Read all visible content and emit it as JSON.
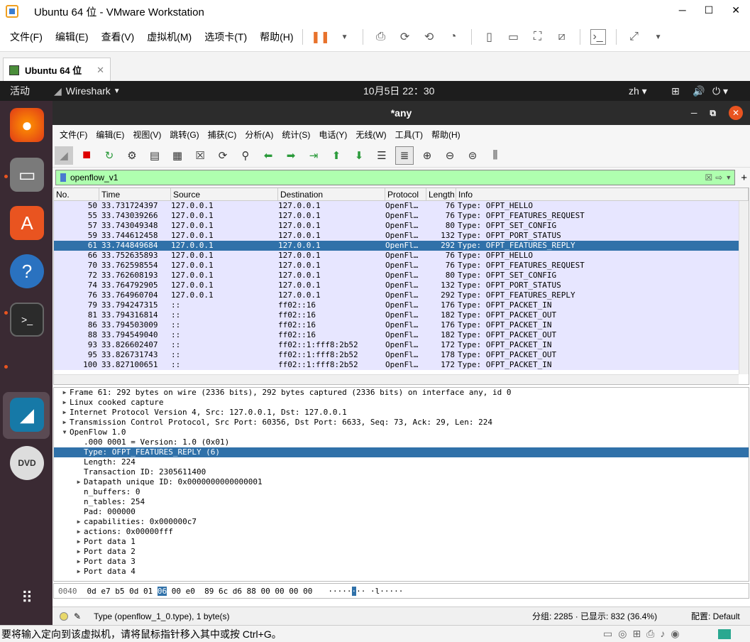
{
  "vmware": {
    "title": "Ubuntu 64 位 - VMware Workstation",
    "menu": [
      "文件(F)",
      "编辑(E)",
      "查看(V)",
      "虚拟机(M)",
      "选项卡(T)",
      "帮助(H)"
    ],
    "tab_label": "Ubuntu 64 位",
    "status_message": "要将输入定向到该虚拟机，请将鼠标指针移入其中或按 Ctrl+G。"
  },
  "gnome": {
    "activities": "活动",
    "app_name": "Wireshark",
    "clock": "10月5日  22：30",
    "input_method": "zh"
  },
  "wireshark": {
    "window_title": "*any",
    "menu": [
      "文件(F)",
      "编辑(E)",
      "视图(V)",
      "跳转(G)",
      "捕获(C)",
      "分析(A)",
      "统计(S)",
      "电话(Y)",
      "无线(W)",
      "工具(T)",
      "帮助(H)"
    ],
    "filter_value": "openflow_v1",
    "columns": [
      "No.",
      "Time",
      "Source",
      "Destination",
      "Protocol",
      "Length",
      "Info"
    ],
    "packets": [
      {
        "no": "50",
        "time": "33.731724397",
        "src": "127.0.0.1",
        "dst": "127.0.0.1",
        "proto": "OpenFl…",
        "len": "76",
        "info": "Type: OFPT_HELLO"
      },
      {
        "no": "55",
        "time": "33.743039266",
        "src": "127.0.0.1",
        "dst": "127.0.0.1",
        "proto": "OpenFl…",
        "len": "76",
        "info": "Type: OFPT_FEATURES_REQUEST"
      },
      {
        "no": "57",
        "time": "33.743049348",
        "src": "127.0.0.1",
        "dst": "127.0.0.1",
        "proto": "OpenFl…",
        "len": "80",
        "info": "Type: OFPT_SET_CONFIG"
      },
      {
        "no": "59",
        "time": "33.744612458",
        "src": "127.0.0.1",
        "dst": "127.0.0.1",
        "proto": "OpenFl…",
        "len": "132",
        "info": "Type: OFPT_PORT_STATUS"
      },
      {
        "no": "61",
        "time": "33.744849684",
        "src": "127.0.0.1",
        "dst": "127.0.0.1",
        "proto": "OpenFl…",
        "len": "292",
        "info": "Type: OFPT_FEATURES_REPLY",
        "selected": true
      },
      {
        "no": "66",
        "time": "33.752635893",
        "src": "127.0.0.1",
        "dst": "127.0.0.1",
        "proto": "OpenFl…",
        "len": "76",
        "info": "Type: OFPT_HELLO"
      },
      {
        "no": "70",
        "time": "33.762598554",
        "src": "127.0.0.1",
        "dst": "127.0.0.1",
        "proto": "OpenFl…",
        "len": "76",
        "info": "Type: OFPT_FEATURES_REQUEST"
      },
      {
        "no": "72",
        "time": "33.762608193",
        "src": "127.0.0.1",
        "dst": "127.0.0.1",
        "proto": "OpenFl…",
        "len": "80",
        "info": "Type: OFPT_SET_CONFIG"
      },
      {
        "no": "74",
        "time": "33.764792905",
        "src": "127.0.0.1",
        "dst": "127.0.0.1",
        "proto": "OpenFl…",
        "len": "132",
        "info": "Type: OFPT_PORT_STATUS"
      },
      {
        "no": "76",
        "time": "33.764960704",
        "src": "127.0.0.1",
        "dst": "127.0.0.1",
        "proto": "OpenFl…",
        "len": "292",
        "info": "Type: OFPT_FEATURES_REPLY"
      },
      {
        "no": "79",
        "time": "33.794247315",
        "src": "::",
        "dst": "ff02::16",
        "proto": "OpenFl…",
        "len": "176",
        "info": "Type: OFPT_PACKET_IN"
      },
      {
        "no": "81",
        "time": "33.794316814",
        "src": "::",
        "dst": "ff02::16",
        "proto": "OpenFl…",
        "len": "182",
        "info": "Type: OFPT_PACKET_OUT"
      },
      {
        "no": "86",
        "time": "33.794503009",
        "src": "::",
        "dst": "ff02::16",
        "proto": "OpenFl…",
        "len": "176",
        "info": "Type: OFPT_PACKET_IN"
      },
      {
        "no": "88",
        "time": "33.794549040",
        "src": "::",
        "dst": "ff02::16",
        "proto": "OpenFl…",
        "len": "182",
        "info": "Type: OFPT_PACKET_OUT"
      },
      {
        "no": "93",
        "time": "33.826602407",
        "src": "::",
        "dst": "ff02::1:fff8:2b52",
        "proto": "OpenFl…",
        "len": "172",
        "info": "Type: OFPT_PACKET_IN"
      },
      {
        "no": "95",
        "time": "33.826731743",
        "src": "::",
        "dst": "ff02::1:fff8:2b52",
        "proto": "OpenFl…",
        "len": "178",
        "info": "Type: OFPT_PACKET_OUT"
      },
      {
        "no": "100",
        "time": "33.827100651",
        "src": "::",
        "dst": "ff02::1:fff8:2b52",
        "proto": "OpenFl…",
        "len": "172",
        "info": "Type: OFPT_PACKET_IN"
      }
    ],
    "details": [
      {
        "indent": 0,
        "tw": "▶",
        "text": "Frame 61: 292 bytes on wire (2336 bits), 292 bytes captured (2336 bits) on interface any, id 0"
      },
      {
        "indent": 0,
        "tw": "▶",
        "text": "Linux cooked capture"
      },
      {
        "indent": 0,
        "tw": "▶",
        "text": "Internet Protocol Version 4, Src: 127.0.0.1, Dst: 127.0.0.1"
      },
      {
        "indent": 0,
        "tw": "▶",
        "text": "Transmission Control Protocol, Src Port: 60356, Dst Port: 6633, Seq: 73, Ack: 29, Len: 224"
      },
      {
        "indent": 0,
        "tw": "▼",
        "text": "OpenFlow 1.0"
      },
      {
        "indent": 1,
        "tw": "",
        "text": ".000 0001 = Version: 1.0 (0x01)"
      },
      {
        "indent": 1,
        "tw": "",
        "text": "Type: OFPT_FEATURES_REPLY (6)",
        "selected": true
      },
      {
        "indent": 1,
        "tw": "",
        "text": "Length: 224"
      },
      {
        "indent": 1,
        "tw": "",
        "text": "Transaction ID: 2305611400"
      },
      {
        "indent": 1,
        "tw": "▶",
        "text": "Datapath unique ID: 0x0000000000000001"
      },
      {
        "indent": 1,
        "tw": "",
        "text": "n_buffers: 0"
      },
      {
        "indent": 1,
        "tw": "",
        "text": "n_tables: 254"
      },
      {
        "indent": 1,
        "tw": "",
        "text": "Pad: 000000"
      },
      {
        "indent": 1,
        "tw": "▶",
        "text": "capabilities: 0x000000c7"
      },
      {
        "indent": 1,
        "tw": "▶",
        "text": "actions: 0x00000fff"
      },
      {
        "indent": 1,
        "tw": "▶",
        "text": "Port data 1"
      },
      {
        "indent": 1,
        "tw": "▶",
        "text": "Port data 2"
      },
      {
        "indent": 1,
        "tw": "▶",
        "text": "Port data 3"
      },
      {
        "indent": 1,
        "tw": "▶",
        "text": "Port data 4"
      }
    ],
    "hex": {
      "offset": "0040",
      "bytes_before": "0d e7 b5 0d 01 ",
      "bytes_hl": "06",
      "bytes_after": " 00 e0  89 6c d6 88 00 00 00 00",
      "ascii_before": "·····",
      "ascii_hl": "·",
      "ascii_after": "·· ·l·····"
    },
    "status": {
      "field": "Type (openflow_1_0.type), 1 byte(s)",
      "packets": "分组: 2285 · 已显示: 832 (36.4%)",
      "profile": "配置: Default"
    }
  }
}
